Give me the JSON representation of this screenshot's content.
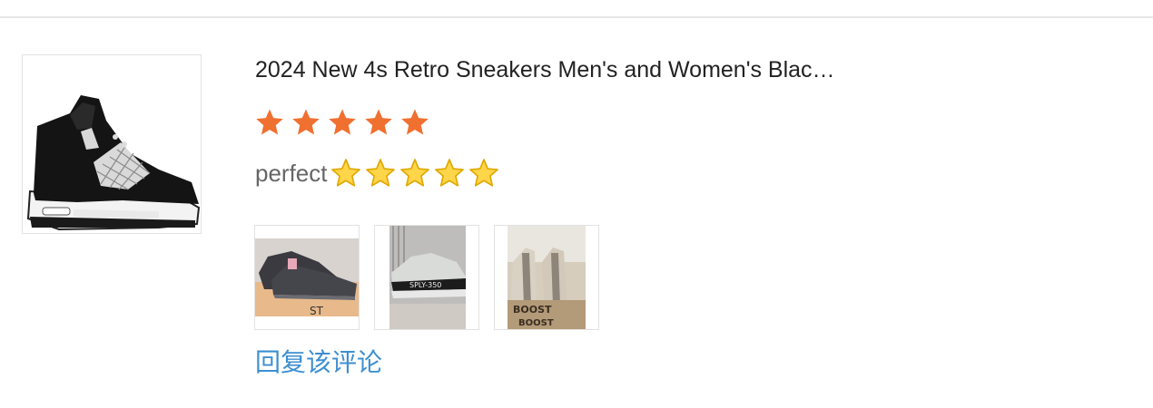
{
  "review": {
    "product_title": "2024 New 4s Retro Sneakers Men's and Women's Blac…",
    "rating": 5,
    "rating_max": 5,
    "rating_color": "#f07030",
    "comment_text": "perfect",
    "comment_emoji": "⭐⭐⭐⭐⭐",
    "reply_label": "回复该评论",
    "link_color": "#3d8fd1"
  }
}
